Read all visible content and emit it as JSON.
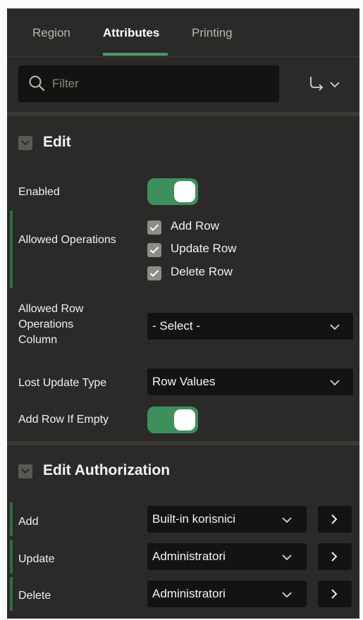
{
  "tabs": [
    {
      "label": "Region"
    },
    {
      "label": "Attributes"
    },
    {
      "label": "Printing"
    }
  ],
  "active_tab": "Attributes",
  "search": {
    "placeholder": "Filter",
    "value": ""
  },
  "sections": {
    "edit": {
      "title": "Edit",
      "enabled": {
        "label": "Enabled",
        "on": true
      },
      "allowed_operations": {
        "label": "Allowed Operations",
        "options": [
          {
            "label": "Add Row",
            "checked": true
          },
          {
            "label": "Update Row",
            "checked": true
          },
          {
            "label": "Delete Row",
            "checked": true
          }
        ]
      },
      "allowed_row_ops_column": {
        "label": "Allowed Row Operations Column",
        "value": "- Select -"
      },
      "lost_update_type": {
        "label": "Lost Update Type",
        "value": "Row Values"
      },
      "add_row_if_empty": {
        "label": "Add Row If Empty",
        "on": true
      }
    },
    "edit_authorization": {
      "title": "Edit Authorization",
      "rows": [
        {
          "label": "Add",
          "value": "Built-in korisnici"
        },
        {
          "label": "Update",
          "value": "Administratori"
        },
        {
          "label": "Delete",
          "value": "Administratori"
        }
      ]
    }
  },
  "colors": {
    "panel_bg": "#2b2a28",
    "input_bg": "#141312",
    "accent_green": "#3f8f5c",
    "checkbox_gray": "#8e8c88"
  },
  "icons": {
    "search": "search-icon",
    "goto": "goto-arrow-icon",
    "chevron": "chevron-down-icon",
    "lov": "chevron-right-icon",
    "check": "check-icon"
  }
}
